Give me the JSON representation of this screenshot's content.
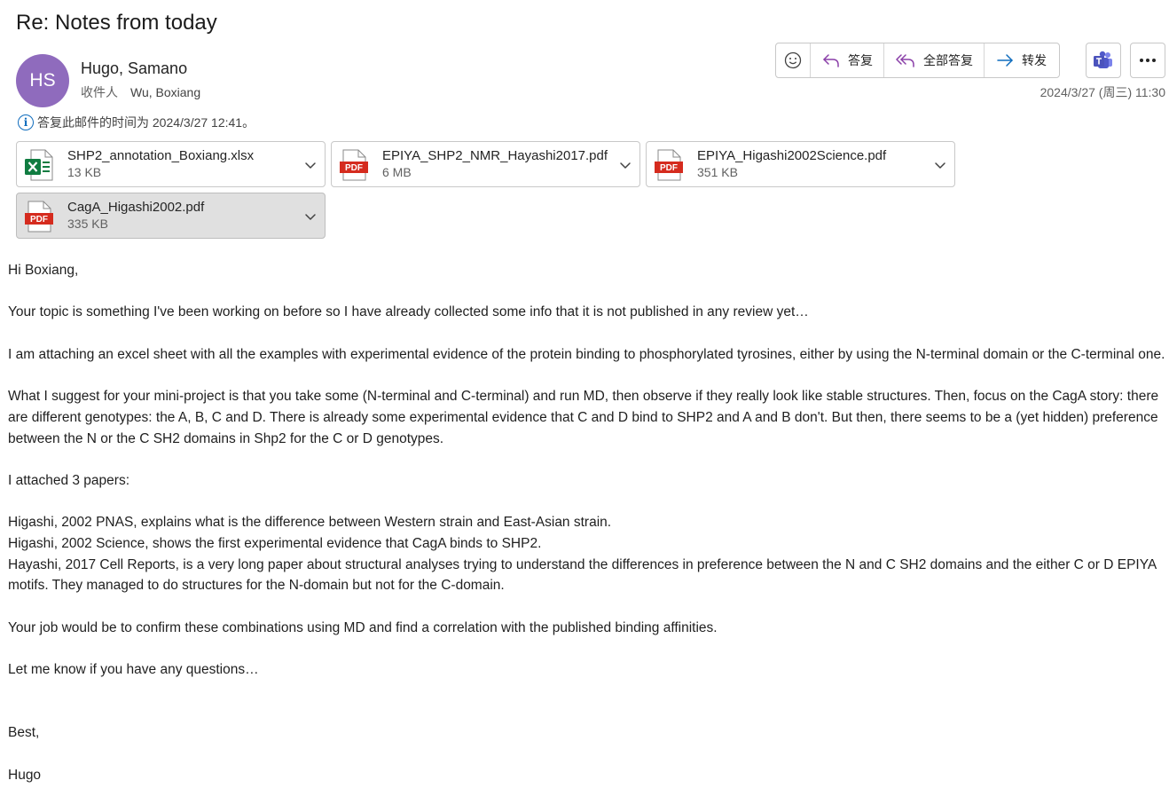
{
  "subject": "Re: Notes from today",
  "sender": {
    "initials": "HS",
    "name": "Hugo, Samano",
    "to_label": "收件人",
    "to": "Wu, Boxiang",
    "avatar_color": "#8f6bbd"
  },
  "toolbar": {
    "reply": "答复",
    "reply_all": "全部答复",
    "forward": "转发"
  },
  "date": "2024/3/27 (周三) 11:30",
  "info_text": "答复此邮件的时间为 2024/3/27 12:41。",
  "attachments": [
    {
      "name": "SHP2_annotation_Boxiang.xlsx",
      "size": "13 KB",
      "type": "excel"
    },
    {
      "name": "EPIYA_SHP2_NMR_Hayashi2017.pdf",
      "size": "6 MB",
      "type": "pdf"
    },
    {
      "name": "EPIYA_Higashi2002Science.pdf",
      "size": "351 KB",
      "type": "pdf"
    },
    {
      "name": "CagA_Higashi2002.pdf",
      "size": "335 KB",
      "type": "pdf",
      "selected": true
    }
  ],
  "body": {
    "greeting": "Hi Boxiang,",
    "p1": "Your topic is something I've been working on before so I have already collected some info that it is not published in any review yet…",
    "p2": "I am attaching an excel sheet with all the examples with experimental evidence of the protein binding to phosphorylated tyrosines, either by using the N-terminal domain or the C-terminal one.",
    "p3": "What I suggest for your mini-project is that you take some (N-terminal and C-terminal) and run MD, then observe if they really look like stable structures. Then, focus on the CagA story: there are different genotypes: the A, B, C and D. There is already some experimental evidence that C and D bind to SHP2 and A and B don't. But then, there seems to be a (yet hidden) preference between the N or the C SH2 domains in Shp2 for the C or D genotypes.",
    "p4": "I attached 3 papers:",
    "ref1": "Higashi, 2002 PNAS, explains what is the difference between Western strain and East-Asian strain.",
    "ref2": "Higashi, 2002 Science, shows the first experimental evidence that CagA binds to SHP2.",
    "ref3": "Hayashi, 2017 Cell Reports, is a very long paper about structural analyses trying to understand the differences in preference between the N and C SH2 domains and the either C or D EPIYA motifs. They managed to do structures for the N-domain but not for the C-domain.",
    "p5": "Your job would be to confirm these combinations using MD and find a correlation with the published binding affinities.",
    "p6": "Let me know if you have any questions…",
    "closing": "Best,",
    "signature": "Hugo"
  }
}
